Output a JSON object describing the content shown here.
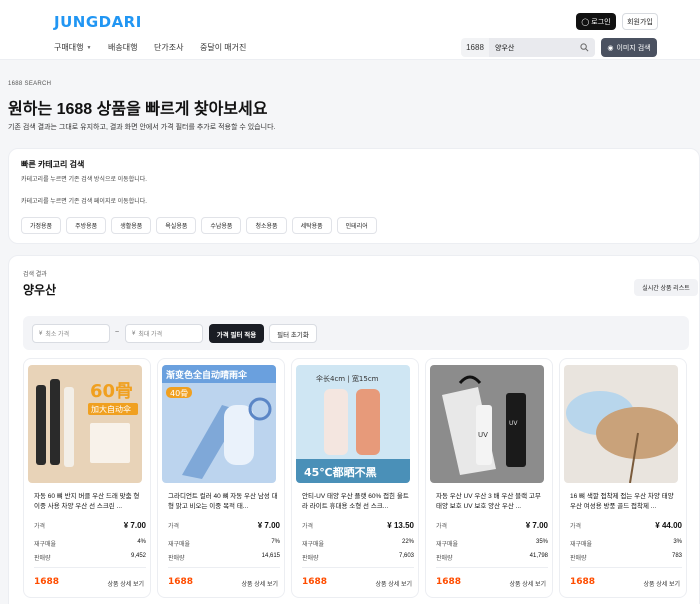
{
  "header": {
    "logo": "JUNGDARI",
    "login_label": "로그인",
    "signup_label": "회원가입",
    "nav": [
      "구매대행",
      "배송대행",
      "단가조사",
      "중달이 매거진"
    ],
    "search_prefix": "1688",
    "search_value": "양우산",
    "image_search_label": "이미지 검색"
  },
  "hero": {
    "eyebrow": "1688 SEARCH",
    "title": "원하는 1688 상품을 빠르게 찾아보세요",
    "desc": "기존 검색 결과는 그대로 유지하고, 결과 화면 안에서 가격 필터를 추가로 적용할 수 있습니다."
  },
  "quick": {
    "title": "빠른 카테고리 검색",
    "sub": "카테고리를 누르면 기존 검색 방식으로 이동합니다.",
    "note": "카테고리를 누르면 기존 검색 페이지로 이동합니다.",
    "categories": [
      "가정용품",
      "주방용품",
      "생활용품",
      "욕실용품",
      "수납용품",
      "청소용품",
      "세탁용품",
      "인테리어"
    ]
  },
  "results": {
    "eyebrow": "검색 결과",
    "title": "양우산",
    "realtime_label": "실시간 상품 리스트",
    "min_placeholder": "최소 가격",
    "max_placeholder": "최대 가격",
    "currency": "¥",
    "tilde": "~",
    "apply_label": "가격 필터 적용",
    "reset_label": "필터 초기화",
    "labels": {
      "price": "가격",
      "repurchase": "재구매율",
      "sales": "판매량"
    },
    "brand": "1688",
    "detail_label": "상품 상세 보기",
    "products": [
      {
        "title": "자동 60 뼈 반지 버클 우산 드래 맞춤 형 이중 사용 차양 우산 선 스크린 ...",
        "price": "¥ 7.00",
        "repurchase": "4%",
        "sales": "9,452",
        "img_text1": "60骨",
        "img_text2": "加大自动伞",
        "colors": [
          "#e8d3b8",
          "#2a2a2a",
          "#f0a020"
        ]
      },
      {
        "title": "그라디언트 컬러 40 뼈 자동 우산 남성 대형 맑고 비오는 이중 목적 태...",
        "price": "¥ 7.00",
        "repurchase": "7%",
        "sales": "14,615",
        "img_text1": "40骨",
        "img_text2": "渐变色全自动晴雨伞",
        "colors": [
          "#bcd4ee",
          "#7fa8d8",
          "#f0a020"
        ]
      },
      {
        "title": "안티-UV 태양 우산 플랫 60% 접힌 울트라 라이트 휴대용 소형 선 스크...",
        "price": "¥ 13.50",
        "repurchase": "22%",
        "sales": "7,603",
        "img_text1": "45℃都晒不黑",
        "img_text2": "伞长4cm | 宽15cm",
        "colors": [
          "#cfe6f3",
          "#e79a7a",
          "#4a90b8"
        ]
      },
      {
        "title": "자동 우산 UV 우산 3 배 우산 블랙 고무 태양 보호 UV 보호 양산 우산 ...",
        "price": "¥ 7.00",
        "repurchase": "35%",
        "sales": "41,798",
        "img_text1": "UV",
        "img_text2": "",
        "colors": [
          "#8c8c8c",
          "#1a1a1a",
          "#e8e8e8"
        ]
      },
      {
        "title": "16 뼈 색깔 접착제 접는 우산 차양 태양 우산 여성용 방풍 골드 접착제 ...",
        "price": "¥ 44.00",
        "repurchase": "3%",
        "sales": "783",
        "img_text1": "",
        "img_text2": "",
        "colors": [
          "#e9e4de",
          "#b8d6ec",
          "#c9a27a"
        ]
      }
    ]
  }
}
